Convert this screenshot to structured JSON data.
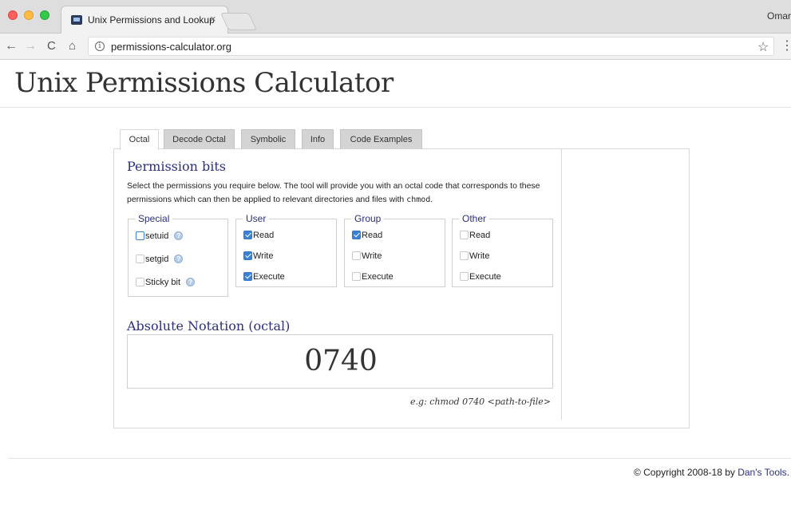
{
  "browser": {
    "tab_title": "Unix Permissions and Lookup",
    "tab_close": "×",
    "profile_name": "Omar",
    "url": "permissions-calculator.org",
    "nav": {
      "back": "←",
      "forward": "→",
      "reload": "C",
      "home": "⌂"
    },
    "star": "☆",
    "menu": "⋮",
    "info": "i"
  },
  "page": {
    "title": "Unix Permissions Calculator"
  },
  "tabs": [
    {
      "label": "Octal",
      "active": true
    },
    {
      "label": "Decode Octal",
      "active": false
    },
    {
      "label": "Symbolic",
      "active": false
    },
    {
      "label": "Info",
      "active": false
    },
    {
      "label": "Code Examples",
      "active": false
    }
  ],
  "permission_bits": {
    "heading": "Permission bits",
    "description": "Select the permissions you require below. The tool will provide you with an octal code that corresponds to these permissions which can then be applied to relevant directories and files with ",
    "description_code": "chmod",
    "description_end": "."
  },
  "groups": {
    "special": {
      "legend": "Special",
      "options": [
        {
          "label": "setuid",
          "checked": false
        },
        {
          "label": "setgid",
          "checked": false
        },
        {
          "label": "Sticky bit",
          "checked": false
        }
      ]
    },
    "user": {
      "legend": "User",
      "options": [
        {
          "label": "Read",
          "checked": true
        },
        {
          "label": "Write",
          "checked": true
        },
        {
          "label": "Execute",
          "checked": true
        }
      ]
    },
    "group": {
      "legend": "Group",
      "options": [
        {
          "label": "Read",
          "checked": true
        },
        {
          "label": "Write",
          "checked": false
        },
        {
          "label": "Execute",
          "checked": false
        }
      ]
    },
    "other": {
      "legend": "Other",
      "options": [
        {
          "label": "Read",
          "checked": false
        },
        {
          "label": "Write",
          "checked": false
        },
        {
          "label": "Execute",
          "checked": false
        }
      ]
    }
  },
  "absolute": {
    "heading": "Absolute Notation (octal)",
    "value": "0740",
    "example": "e.g: chmod 0740 <path-to-file>"
  },
  "footer": {
    "copyright": "© Copyright 2008-18 by ",
    "link": "Dan's Tools",
    "end": "."
  },
  "colors": {
    "heading": "#2c2f7e",
    "checkbox_checked": "#3b82d6"
  }
}
